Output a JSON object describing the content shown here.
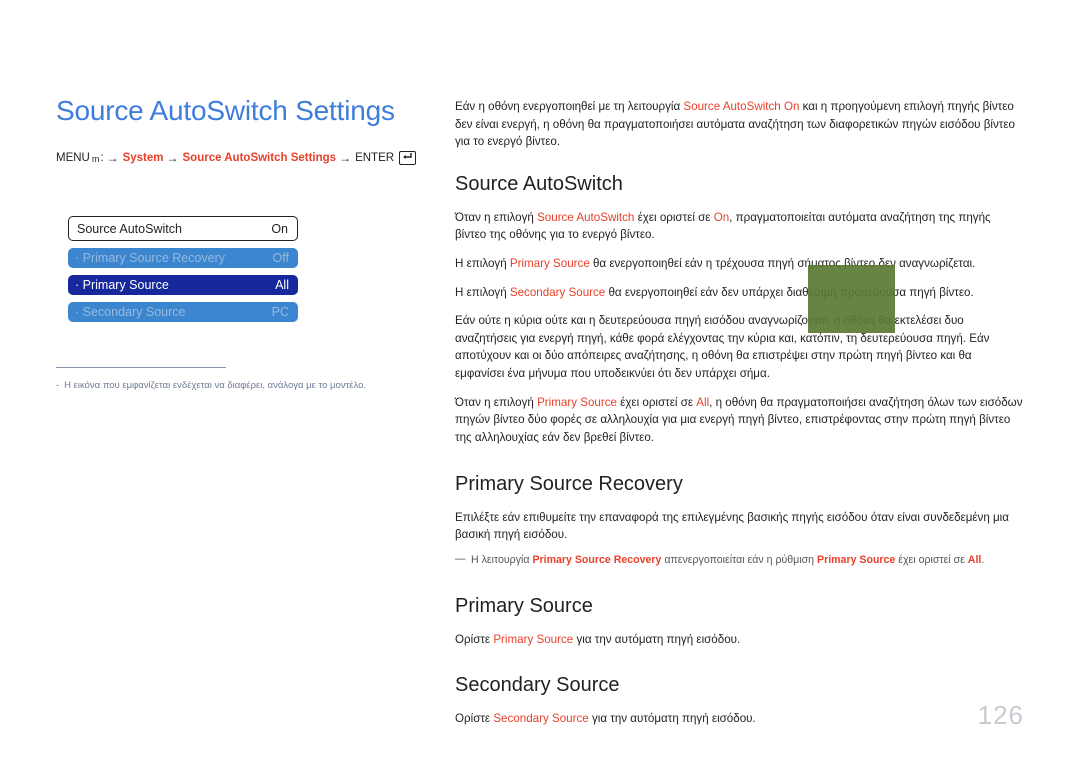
{
  "page": {
    "title": "Source AutoSwitch Settings",
    "number": "126"
  },
  "menu_path": {
    "menu_label": "MENU",
    "menu_glyph": "m",
    "colon": ":",
    "arrow": "→",
    "step1": "System",
    "step2": "Source AutoSwitch Settings",
    "enter_label": "ENTER",
    "enter_icon": "enter-key-icon"
  },
  "osd": {
    "header": {
      "label": "Source AutoSwitch",
      "value": "On"
    },
    "rows": [
      {
        "label": "· Primary Source Recovery",
        "value": "Off",
        "state": "dim"
      },
      {
        "label": "· Primary Source",
        "value": "All",
        "state": "selected"
      },
      {
        "label": "· Secondary Source",
        "value": "PC",
        "state": "dim"
      }
    ]
  },
  "left_note": {
    "bullet": "-",
    "text": "Η εικόνα που εμφανίζεται ενδέχεται να διαφέρει, ανάλογα με το μοντέλο."
  },
  "intro": {
    "p1_a": "Εάν η οθόνη ενεργοποιηθεί με τη λειτουργία ",
    "p1_r1": "Source AutoSwitch On",
    "p1_b": " και η προηγούμενη επιλογή πηγής βίντεο δεν είναι ενεργή, η οθόνη θα πραγματοποιήσει αυτόματα αναζήτηση των διαφορετικών πηγών εισόδου βίντεο για το ενεργό βίντεο."
  },
  "sections": [
    {
      "heading": "Source AutoSwitch",
      "paragraphs": [
        {
          "a": "Όταν η επιλογή ",
          "r1": "Source AutoSwitch",
          "b": " έχει οριστεί σε ",
          "r2": "On",
          "c": ", πραγματοποιείται αυτόματα αναζήτηση της πηγής βίντεο της οθόνης για το ενεργό βίντεο."
        },
        {
          "a": "Η επιλογή ",
          "r1": "Primary Source",
          "b": " θα ενεργοποιηθεί εάν η τρέχουσα πηγή σήματος βίντεο δεν αναγνωρίζεται."
        },
        {
          "a": "Η επιλογή ",
          "r1": "Secondary Source",
          "b": " θα ενεργοποιηθεί εάν δεν υπάρχει διαθέσιμη πρωτεύουσα πηγή βίντεο."
        },
        {
          "a": "Εάν ούτε η κύρια ούτε και η δευτερεύουσα πηγή εισόδου αναγνωρίζονται, η οθόνη θα εκτελέσει δυο αναζητήσεις για ενεργή πηγή, κάθε φορά ελέγχοντας την κύρια και, κατόπιν, τη δευτερεύουσα πηγή. Εάν αποτύχουν και οι δύο απόπειρες αναζήτησης, η οθόνη θα επιστρέψει στην πρώτη πηγή βίντεο και θα εμφανίσει ένα μήνυμα που υποδεικνύει ότι δεν υπάρχει σήμα."
        },
        {
          "a": "Όταν η επιλογή ",
          "r1": "Primary Source",
          "b": " έχει οριστεί σε ",
          "r2": "All",
          "c": ", η οθόνη θα πραγματοποιήσει αναζήτηση όλων των εισόδων πηγών βίντεο δύο φορές σε αλληλουχία για μια ενεργή πηγή βίντεο, επιστρέφοντας στην πρώτη πηγή βίντεο της αλληλουχίας εάν δεν βρεθεί βίντεο."
        }
      ]
    },
    {
      "heading": "Primary Source Recovery",
      "paragraphs": [
        {
          "a": "Επιλέξτε εάν επιθυμείτε την επαναφορά της επιλεγμένης βασικής πηγής εισόδου όταν είναι συνδεδεμένη μια βασική πηγή εισόδου."
        }
      ],
      "note": {
        "bullet": "―",
        "a": "Η λειτουργία ",
        "r1": "Primary Source Recovery",
        "b": " απενεργοποιείται εάν η ρύθμιση ",
        "r2": "Primary Source",
        "c": " έχει οριστεί σε ",
        "r3": "All",
        "d": "."
      }
    },
    {
      "heading": "Primary Source",
      "paragraphs": [
        {
          "a": "Ορίστε ",
          "r1": "Primary Source",
          "b": " για την αυτόματη πηγή εισόδου."
        }
      ]
    },
    {
      "heading": "Secondary Source",
      "paragraphs": [
        {
          "a": "Ορίστε ",
          "r1": "Secondary Source",
          "b": " για την αυτόματη πηγή εισόδου."
        }
      ]
    }
  ],
  "overlay": {
    "name": "green-selection-overlay",
    "color": "#5a7a33"
  },
  "colors": {
    "title_blue": "#3d7ddd",
    "accent_red": "#e8402a",
    "osd_row_dim": "#3c86cf",
    "osd_row_selected": "#17279c",
    "page_number_gray": "#c8cbd2"
  }
}
